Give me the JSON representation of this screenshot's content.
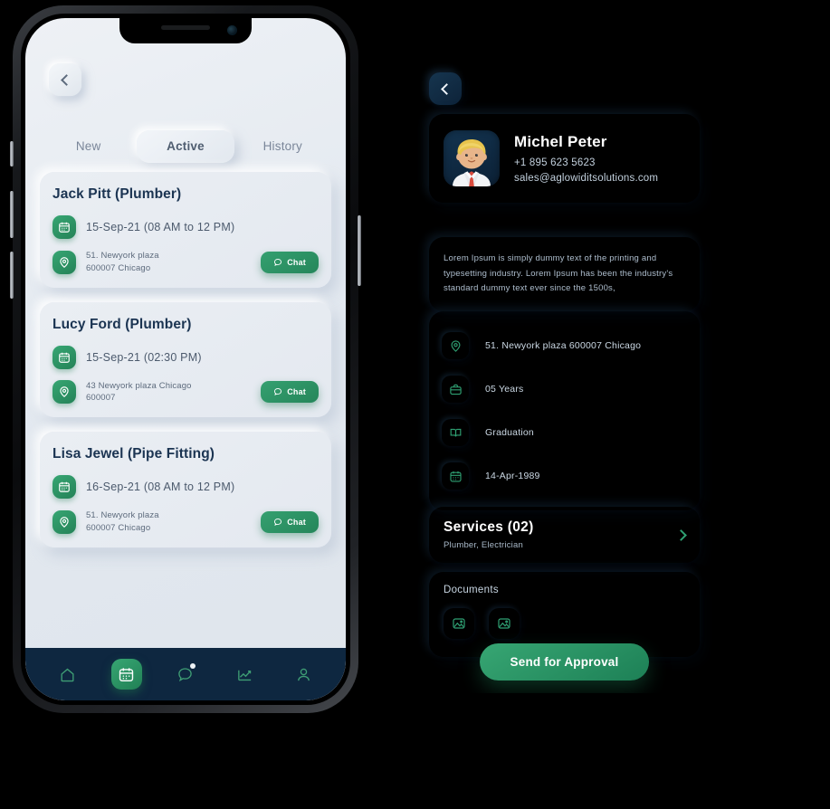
{
  "left_phone": {
    "back_icon": "chevron-left-icon",
    "tabs": [
      {
        "label": "New",
        "active": false
      },
      {
        "label": "Active",
        "active": true
      },
      {
        "label": "History",
        "active": false
      }
    ],
    "jobs": [
      {
        "title": "Jack Pitt (Plumber)",
        "date": "15-Sep-21 (08 AM to 12 PM)",
        "address_line1": "51. Newyork plaza",
        "address_line2": "600007 Chicago",
        "chat_label": "Chat"
      },
      {
        "title": "Lucy Ford (Plumber)",
        "date": "15-Sep-21 (02:30 PM)",
        "address_line1": "43 Newyork plaza Chicago",
        "address_line2": "600007",
        "chat_label": "Chat"
      },
      {
        "title": "Lisa Jewel (Pipe Fitting)",
        "date": "16-Sep-21 (08 AM to 12 PM)",
        "address_line1": "51. Newyork plaza",
        "address_line2": "600007 Chicago",
        "chat_label": "Chat"
      }
    ],
    "bottom_nav": [
      {
        "icon": "home-icon",
        "active": false,
        "badge": false
      },
      {
        "icon": "calendar-icon",
        "active": true,
        "badge": false
      },
      {
        "icon": "chat-bubble-icon",
        "active": false,
        "badge": true
      },
      {
        "icon": "analytics-chart-icon",
        "active": false,
        "badge": false
      },
      {
        "icon": "user-profile-icon",
        "active": false,
        "badge": false
      }
    ]
  },
  "right_phone": {
    "back_icon": "chevron-left-icon",
    "profile": {
      "avatar": "male-avatar-blonde-redtie",
      "name": "Michel Peter",
      "phone": "+1 895 623 5623",
      "email": "sales@aglowiditsolutions.com"
    },
    "about": "Lorem Ipsum is simply dummy text of the printing and typesetting industry. Lorem Ipsum has been the industry's standard dummy text ever since the 1500s,",
    "details": [
      {
        "icon": "location-pin-icon",
        "text": "51. Newyork plaza 600007 Chicago"
      },
      {
        "icon": "briefcase-icon",
        "text": "05 Years"
      },
      {
        "icon": "book-icon",
        "text": "Graduation"
      },
      {
        "icon": "calendar-icon",
        "text": "14-Apr-1989"
      }
    ],
    "services": {
      "title": "Services  (02)",
      "subtitle": "Plumber, Electrician",
      "chevron": "chevron-right-icon"
    },
    "documents": {
      "title": "Documents",
      "thumbs": [
        "image-placeholder-icon",
        "image-placeholder-icon"
      ]
    },
    "approve_button": "Send for Approval"
  },
  "colors": {
    "accent_green": "#2e9e6b",
    "dark_navy": "#0e2740",
    "light_bg": "#e4e9f0",
    "title_navy": "#1b3452"
  }
}
